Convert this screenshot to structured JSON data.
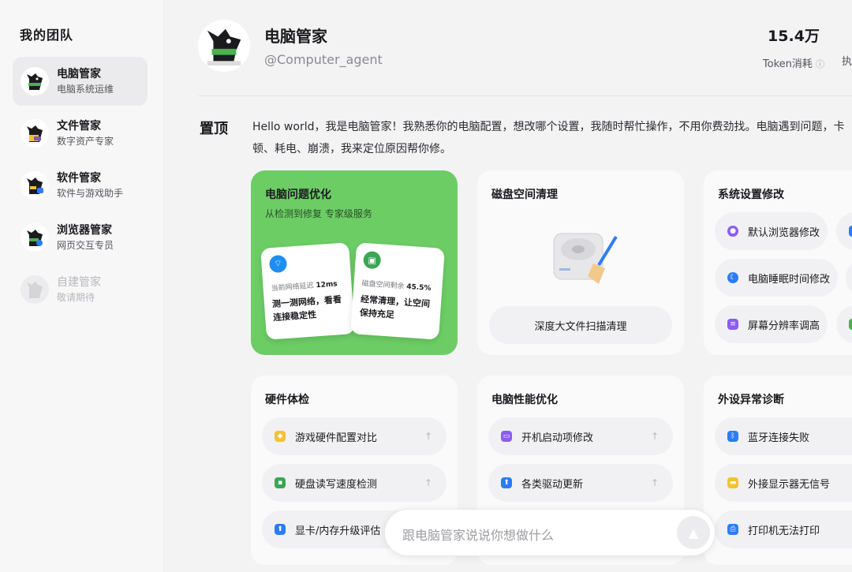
{
  "sidebar": {
    "title": "我的团队",
    "agents": [
      {
        "name": "电脑管家",
        "desc": "电脑系统运维"
      },
      {
        "name": "文件管家",
        "desc": "数字资产专家"
      },
      {
        "name": "软件管家",
        "desc": "软件与游戏助手"
      },
      {
        "name": "浏览器管家",
        "desc": "网页交互专员"
      },
      {
        "name": "自建管家",
        "desc": "敬请期待"
      }
    ]
  },
  "header": {
    "name": "电脑管家",
    "handle": "@Computer_agent",
    "stat_value": "15.4万",
    "stat_label": "Token消耗",
    "stat2_label": "执"
  },
  "pinned": {
    "label": "置顶",
    "intro": "Hello world，我是电脑管家！我熟悉你的电脑配置，想改哪个设置，我随时帮忙操作，不用你费劲找。电脑遇到问题，卡顿、耗电、崩溃，我来定位原因帮你修。"
  },
  "cards": {
    "optimize": {
      "title": "电脑问题优化",
      "subtitle": "从检测到修复 专家级服务",
      "mini1_meta": "当前网络延迟",
      "mini1_value": "12ms",
      "mini1_text": "测一测网络，看看连接稳定性",
      "mini2_meta": "磁盘空间剩余",
      "mini2_value": "45.5%",
      "mini2_text": "经常清理，让空间保持充足"
    },
    "disk": {
      "title": "磁盘空间清理",
      "button": "深度大文件扫描清理"
    },
    "system": {
      "title": "系统设置修改",
      "items": [
        "默认浏览器修改",
        "电脑睡眠时间修改",
        "屏幕分辨率调高"
      ]
    },
    "hardware": {
      "title": "硬件体检",
      "items": [
        "游戏硬件配置对比",
        "硬盘读写速度检测",
        "显卡/内存升级评估"
      ]
    },
    "performance": {
      "title": "电脑性能优化",
      "items": [
        "开机启动项修改",
        "各类驱动更新"
      ]
    },
    "peripheral": {
      "title": "外设异常诊断",
      "items": [
        "蓝牙连接失败",
        "外接显示器无信号",
        "打印机无法打印"
      ]
    }
  },
  "chat": {
    "placeholder": "跟电脑管家说说你想做什么"
  },
  "colors": {
    "accent_green": "#6ccd65",
    "sidebar_bg": "#f7f7f8"
  }
}
